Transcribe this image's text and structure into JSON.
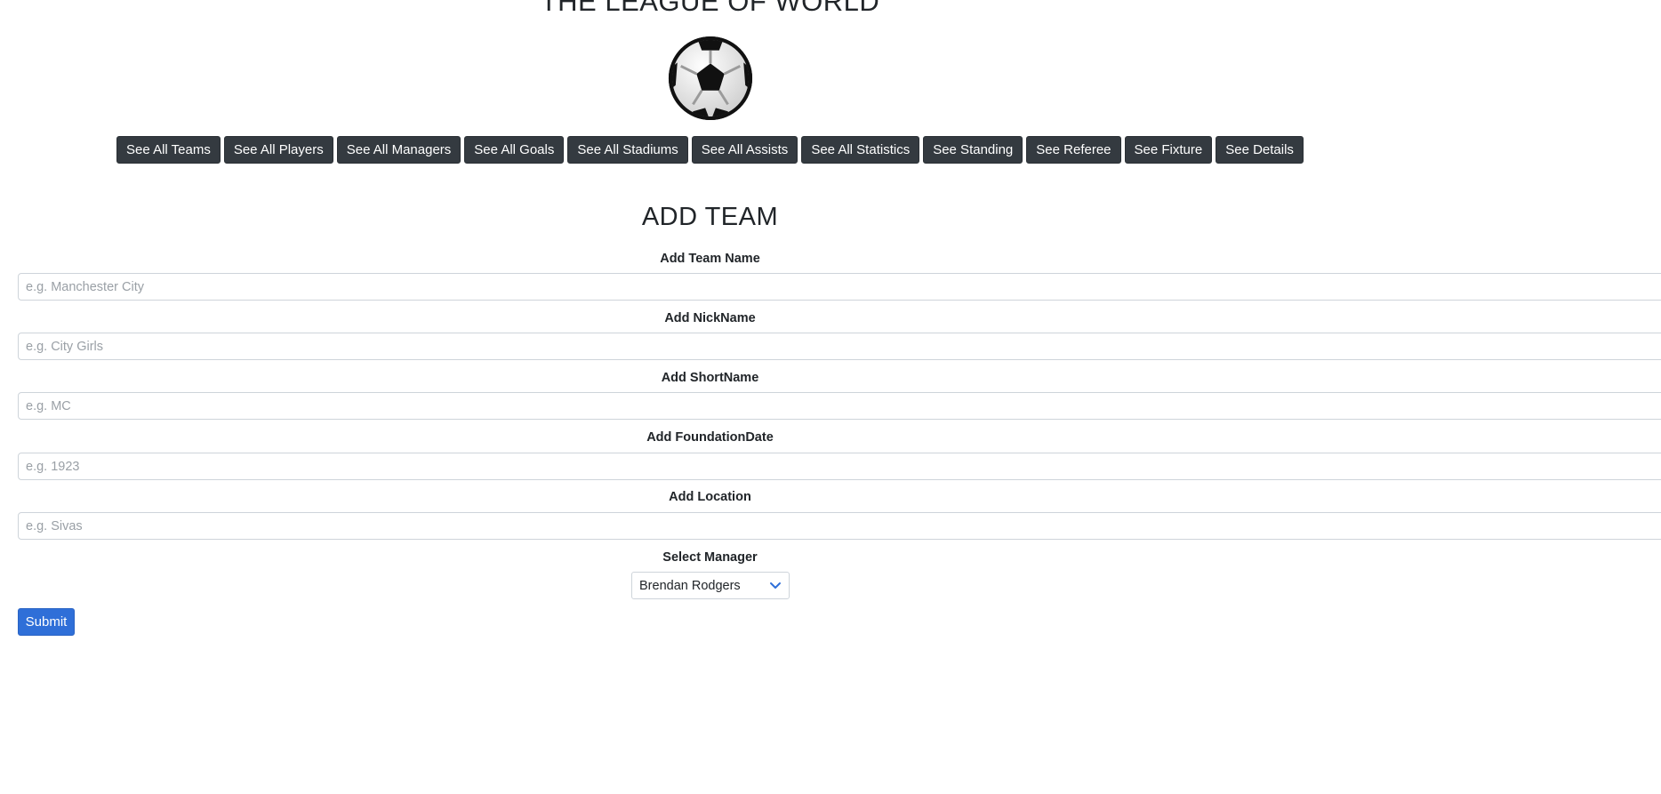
{
  "header": {
    "title": "THE LEAGUE OF WORLD",
    "logo_icon": "soccer-ball-icon"
  },
  "nav": [
    {
      "id": "teams",
      "label": "See All Teams"
    },
    {
      "id": "players",
      "label": "See All Players"
    },
    {
      "id": "managers",
      "label": "See All Managers"
    },
    {
      "id": "goals",
      "label": "See All Goals"
    },
    {
      "id": "stadiums",
      "label": "See All Stadiums"
    },
    {
      "id": "assists",
      "label": "See All Assists"
    },
    {
      "id": "statistics",
      "label": "See All Statistics"
    },
    {
      "id": "standing",
      "label": "See Standing"
    },
    {
      "id": "referee",
      "label": "See Referee"
    },
    {
      "id": "fixture",
      "label": "See Fixture"
    },
    {
      "id": "details",
      "label": "See Details"
    }
  ],
  "form": {
    "title": "ADD TEAM",
    "fields": {
      "team_name": {
        "label": "Add Team Name",
        "placeholder": "e.g. Manchester City",
        "value": ""
      },
      "nickname": {
        "label": "Add NickName",
        "placeholder": "e.g. City Girls",
        "value": ""
      },
      "shortname": {
        "label": "Add ShortName",
        "placeholder": "e.g. MC",
        "value": ""
      },
      "foundation_date": {
        "label": "Add FoundationDate",
        "placeholder": "e.g. 1923",
        "value": ""
      },
      "location": {
        "label": "Add Location",
        "placeholder": "e.g. Sivas",
        "value": ""
      }
    },
    "manager": {
      "label": "Select Manager",
      "selected": "Brendan Rodgers",
      "icon": "chevron-down-icon",
      "accent": "#2f6fd8"
    },
    "submit_label": "Submit"
  },
  "colors": {
    "nav_button_bg": "#343a40",
    "primary": "#2f6fd8",
    "border": "#ced4da"
  }
}
